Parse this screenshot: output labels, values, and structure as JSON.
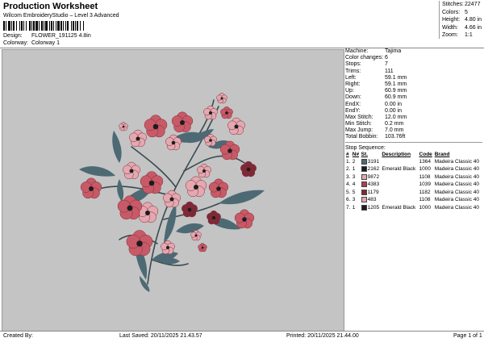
{
  "header": {
    "title": "Production Worksheet",
    "subtitle": "Wilcom EmbroideryStudio – Level 3 Advanced",
    "design_label": "Design:",
    "design_value": "FLOWER_191125 4.8in",
    "colorway_label": "Colorway:",
    "colorway_value": "Colorway 1"
  },
  "stats": [
    {
      "label": "Stitches:",
      "value": "22477"
    },
    {
      "label": "Colors:",
      "value": "5"
    },
    {
      "label": "Height:",
      "value": "4.80 in"
    },
    {
      "label": "Width:",
      "value": "4.66 in"
    },
    {
      "label": "Zoom:",
      "value": "1:1"
    }
  ],
  "machine_info": [
    {
      "label": "Machine:",
      "value": "Tajima"
    },
    {
      "label": "Color changes:",
      "value": "6"
    },
    {
      "label": "Stops:",
      "value": "7"
    },
    {
      "label": "Trims:",
      "value": "111"
    },
    {
      "label": "Left:",
      "value": "59.1 mm"
    },
    {
      "label": "Right:",
      "value": "59.1 mm"
    },
    {
      "label": "Up:",
      "value": "60.9 mm"
    },
    {
      "label": "Down:",
      "value": "60.9 mm"
    },
    {
      "label": "EndX:",
      "value": "0.00 in"
    },
    {
      "label": "EndY:",
      "value": "0.00 in"
    },
    {
      "label": "Max Stitch:",
      "value": "12.0 mm"
    },
    {
      "label": "Min Stitch:",
      "value": "0.2 mm"
    },
    {
      "label": "Max Jump:",
      "value": "7.0 mm"
    },
    {
      "label": "Total Bobbin:",
      "value": "103.76ft"
    }
  ],
  "stop_sequence": {
    "title": "Stop Sequence:",
    "columns": [
      "#",
      "N#",
      "St.",
      "Description",
      "Code",
      "Brand"
    ],
    "rows": [
      {
        "num": "1.",
        "n": "2",
        "color": "#4d6a74",
        "st": "3191",
        "desc": "",
        "code": "1364",
        "brand": "Madeira Classic 40"
      },
      {
        "num": "2.",
        "n": "1",
        "color": "#1c1c1c",
        "st": "2162",
        "desc": "Emerald Black",
        "code": "1000",
        "brand": "Madeira Classic 40"
      },
      {
        "num": "3.",
        "n": "3",
        "color": "#e3a8b0",
        "st": "9872",
        "desc": "",
        "code": "1108",
        "brand": "Madeira Classic 40"
      },
      {
        "num": "4.",
        "n": "4",
        "color": "#b53a4a",
        "st": "4383",
        "desc": "",
        "code": "1039",
        "brand": "Madeira Classic 40"
      },
      {
        "num": "5.",
        "n": "5",
        "color": "#7e2a36",
        "st": "1179",
        "desc": "",
        "code": "1182",
        "brand": "Madeira Classic 40"
      },
      {
        "num": "6.",
        "n": "3",
        "color": "#e3a8b0",
        "st": "483",
        "desc": "",
        "code": "1108",
        "brand": "Madeira Classic 40"
      },
      {
        "num": "7.",
        "n": "1",
        "color": "#1c1c1c",
        "st": "1205",
        "desc": "Emerald Black",
        "code": "1000",
        "brand": "Madeira Classic 40"
      }
    ]
  },
  "footer": {
    "created_by": "Created By:",
    "last_saved": "Last Saved: 20/11/2025 21.43.57",
    "printed": "Printed: 20/11/2025 21.44.00",
    "page": "Page 1 of 1"
  },
  "design_colors": {
    "background": "#c4c4c4",
    "leaf": "#4d6a74",
    "stem": "#3a4a4f",
    "petal_light": "#e3a8b0",
    "petal_mid": "#c85a68",
    "petal_dark": "#7e2a36",
    "center": "#1c1c1c"
  }
}
